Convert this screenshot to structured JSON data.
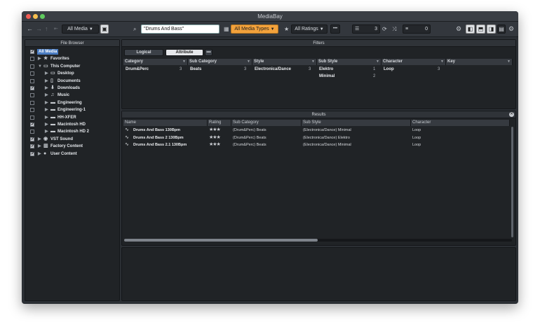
{
  "window": {
    "title": "MediaBay"
  },
  "toolbar": {
    "media_filter": "All Media",
    "search_value": "\"Drums And Bass\"",
    "media_types": "All Media Types",
    "ratings": "All Ratings",
    "results_count": "3",
    "preview_count": "0"
  },
  "file_browser": {
    "title": "File Browser",
    "items": [
      {
        "label": "All Media",
        "checked": true,
        "selected": true,
        "level": 0,
        "icon": ""
      },
      {
        "label": "Favorites",
        "checked": false,
        "level": 0,
        "icon": "star-icon"
      },
      {
        "label": "This Computer",
        "checked": false,
        "level": 0,
        "icon": "monitor-icon"
      },
      {
        "label": "Desktop",
        "checked": false,
        "level": 1,
        "icon": "desktop-icon"
      },
      {
        "label": "Documents",
        "checked": false,
        "level": 1,
        "icon": "document-icon"
      },
      {
        "label": "Downloads",
        "checked": true,
        "level": 1,
        "icon": "download-icon"
      },
      {
        "label": "Music",
        "checked": false,
        "level": 1,
        "icon": "music-icon"
      },
      {
        "label": "Engineering",
        "checked": false,
        "level": 1,
        "icon": "drive-icon"
      },
      {
        "label": "Engineering-1",
        "checked": false,
        "level": 1,
        "icon": "drive-icon"
      },
      {
        "label": "HH-XFER",
        "checked": false,
        "level": 1,
        "icon": "drive-icon"
      },
      {
        "label": "Macintosh HD",
        "checked": true,
        "level": 1,
        "icon": "drive-icon"
      },
      {
        "label": "Macintosh HD 2",
        "checked": false,
        "level": 1,
        "icon": "drive-icon"
      },
      {
        "label": "VST Sound",
        "checked": true,
        "level": 0,
        "icon": "disc-icon"
      },
      {
        "label": "Factory Content",
        "checked": true,
        "level": 0,
        "icon": "library-icon"
      },
      {
        "label": "User Content",
        "checked": true,
        "level": 0,
        "icon": "user-icon"
      }
    ]
  },
  "filters": {
    "title": "Filters",
    "tabs": [
      {
        "label": "Logical",
        "active": false
      },
      {
        "label": "Attribute",
        "active": true
      }
    ],
    "columns": [
      {
        "header": "Category",
        "values": [
          {
            "label": "Drum&Perc",
            "count": "3"
          }
        ]
      },
      {
        "header": "Sub Category",
        "values": [
          {
            "label": "Beats",
            "count": "3"
          }
        ]
      },
      {
        "header": "Style",
        "values": [
          {
            "label": "Electronica/Dance",
            "count": "3"
          }
        ]
      },
      {
        "header": "Sub Style",
        "values": [
          {
            "label": "Elektro",
            "count": "1"
          },
          {
            "label": "Minimal",
            "count": "2"
          }
        ]
      },
      {
        "header": "Character",
        "values": [
          {
            "label": "Loop",
            "count": "3"
          }
        ]
      },
      {
        "header": "Key",
        "values": []
      }
    ]
  },
  "results": {
    "title": "Results",
    "headers": [
      "Name",
      "Rating",
      "Sub Category",
      "Sub Style",
      "Character"
    ],
    "rows": [
      {
        "name": "Drums And Bass 130Bpm",
        "rating": 3,
        "sub_category": "(Drum&Perc) Beats",
        "sub_style": "(Electronica/Dance) Minimal",
        "character": "Loop"
      },
      {
        "name": "Drums And Bass 2 130Bpm",
        "rating": 3,
        "sub_category": "(Drum&Perc) Beats",
        "sub_style": "(Electronica/Dance) Elektro",
        "character": "Loop"
      },
      {
        "name": "Drums And Bass 2.1 130Bpm",
        "rating": 3,
        "sub_category": "(Drum&Perc) Beats",
        "sub_style": "(Electronica/Dance) Minimal",
        "character": "Loop"
      }
    ]
  }
}
